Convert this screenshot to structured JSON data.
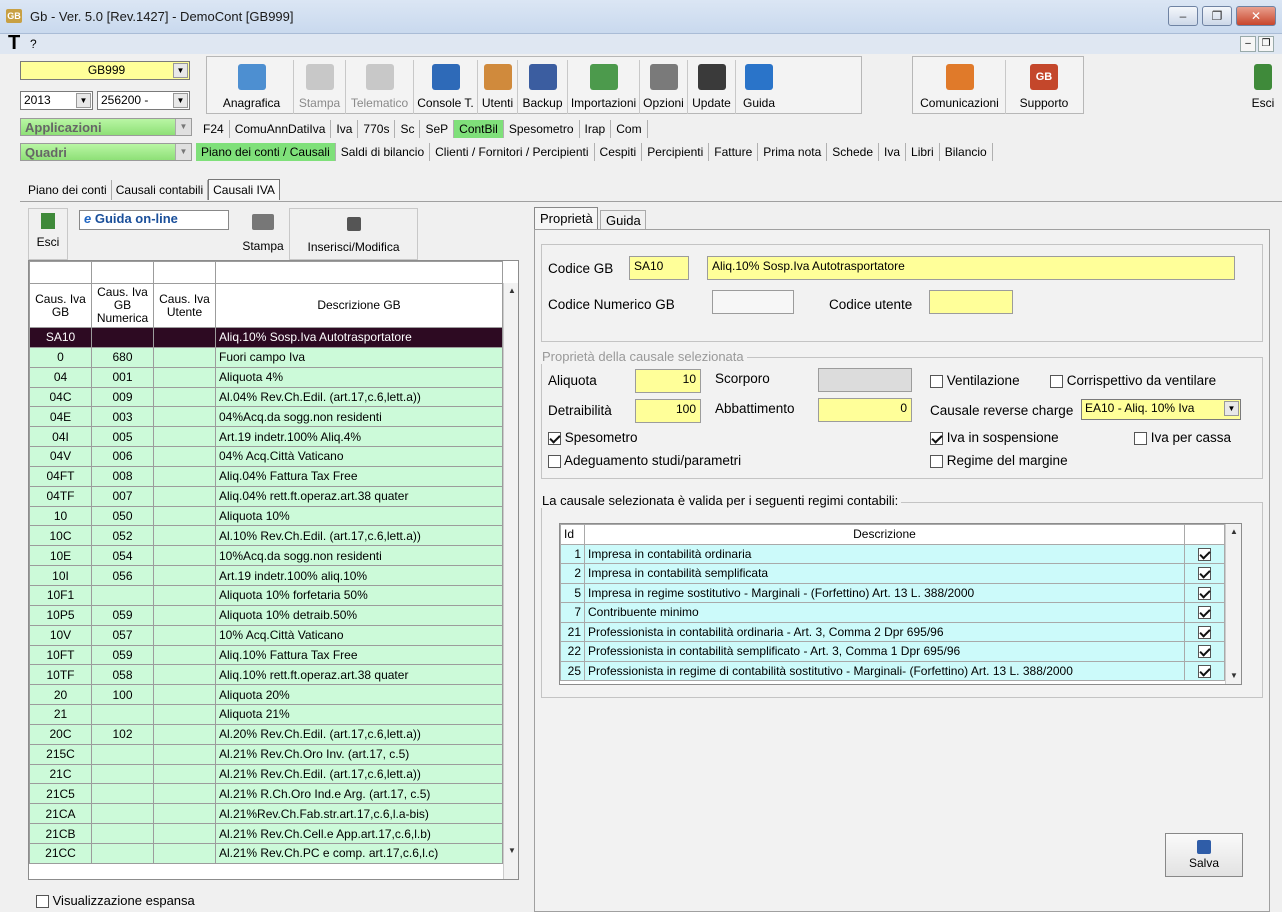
{
  "window": {
    "title": "Gb - Ver. 5.0 [Rev.1427] - DemoCont [GB999]",
    "icon_text": "GB",
    "minimize": "–",
    "restore": "❐",
    "close": "✕"
  },
  "menu": {
    "t": "T",
    "q": "?"
  },
  "company": {
    "code": "GB999",
    "year": "2013",
    "account": "256200 -"
  },
  "toolbar": {
    "buttons": [
      {
        "label": "Anagrafica",
        "icon": "address-card-icon",
        "enabled": true
      },
      {
        "label": "Stampa",
        "icon": "printer-icon",
        "enabled": false
      },
      {
        "label": "Telematico",
        "icon": "telematic-icon",
        "enabled": false
      },
      {
        "label": "Console T.",
        "icon": "console-icon",
        "enabled": true
      },
      {
        "label": "Utenti",
        "icon": "users-icon",
        "enabled": true
      },
      {
        "label": "Backup",
        "icon": "backup-icon",
        "enabled": true
      },
      {
        "label": "Importazioni",
        "icon": "import-icon",
        "enabled": true
      },
      {
        "label": "Opzioni",
        "icon": "wrench-icon",
        "enabled": true
      },
      {
        "label": "Update",
        "icon": "update-icon",
        "enabled": true
      },
      {
        "label": "Guida",
        "icon": "help-icon",
        "enabled": true
      }
    ],
    "comunicazioni": "Comunicazioni",
    "supporto": "Supporto",
    "esci": "Esci"
  },
  "nav": {
    "applicazioni": "Applicazioni",
    "quadri": "Quadri",
    "apps": [
      "F24",
      "ComuAnnDatiIva",
      "Iva",
      "770s",
      "Sc",
      "SeP",
      "ContBil",
      "Spesometro",
      "Irap",
      "Com"
    ],
    "active_app": "ContBil",
    "quadri_items": [
      "Piano dei conti / Causali",
      "Saldi di bilancio",
      "Clienti / Fornitori / Percipienti",
      "Cespiti",
      "Percipienti",
      "Fatture",
      "Prima nota",
      "Schede",
      "Iva",
      "Libri",
      "Bilancio"
    ],
    "active_quadro": "Piano dei conti / Causali"
  },
  "subtabs": {
    "items": [
      "Piano dei conti",
      "Causali contabili",
      "Causali IVA"
    ],
    "active": "Causali IVA"
  },
  "left": {
    "esci": "Esci",
    "guida": "Guida on-line",
    "stampa": "Stampa",
    "inserisci": "Inserisci/Modifica",
    "headers": [
      "Caus. Iva GB",
      "Caus. Iva GB Numerica",
      "Caus. Iva Utente",
      "Descrizione GB"
    ],
    "rows": [
      [
        "SA10",
        "",
        "",
        "Aliq.10% Sosp.Iva Autotrasportatore"
      ],
      [
        "0",
        "680",
        "",
        "Fuori campo Iva"
      ],
      [
        "04",
        "001",
        "",
        "Aliquota 4%"
      ],
      [
        "04C",
        "009",
        "",
        "Al.04% Rev.Ch.Edil. (art.17,c.6,lett.a))"
      ],
      [
        "04E",
        "003",
        "",
        "04%Acq.da sogg.non residenti"
      ],
      [
        "04I",
        "005",
        "",
        "Art.19 indetr.100% Aliq.4%"
      ],
      [
        "04V",
        "006",
        "",
        "04% Acq.Città Vaticano"
      ],
      [
        "04FT",
        "008",
        "",
        "Aliq.04% Fattura Tax Free"
      ],
      [
        "04TF",
        "007",
        "",
        "Aliq.04% rett.ft.operaz.art.38 quater"
      ],
      [
        "10",
        "050",
        "",
        "Aliquota 10%"
      ],
      [
        "10C",
        "052",
        "",
        "Al.10% Rev.Ch.Edil. (art.17,c.6,lett.a))"
      ],
      [
        "10E",
        "054",
        "",
        "10%Acq.da sogg.non residenti"
      ],
      [
        "10I",
        "056",
        "",
        "Art.19 indetr.100% aliq.10%"
      ],
      [
        "10F1",
        "",
        "",
        "Aliquota 10% forfetaria 50%"
      ],
      [
        "10P5",
        "059",
        "",
        "Aliquota 10% detraib.50%"
      ],
      [
        "10V",
        "057",
        "",
        "10% Acq.Città Vaticano"
      ],
      [
        "10FT",
        "059",
        "",
        "Aliq.10% Fattura Tax Free"
      ],
      [
        "10TF",
        "058",
        "",
        "Aliq.10% rett.ft.operaz.art.38 quater"
      ],
      [
        "20",
        "100",
        "",
        "Aliquota 20%"
      ],
      [
        "21",
        "",
        "",
        "Aliquota 21%"
      ],
      [
        "20C",
        "102",
        "",
        "Al.20% Rev.Ch.Edil. (art.17,c.6,lett.a))"
      ],
      [
        "215C",
        "",
        "",
        "Al.21% Rev.Ch.Oro Inv. (art.17, c.5)"
      ],
      [
        "21C",
        "",
        "",
        "Al.21% Rev.Ch.Edil. (art.17,c.6,lett.a))"
      ],
      [
        "21C5",
        "",
        "",
        "Al.21% R.Ch.Oro Ind.e Arg. (art.17, c.5)"
      ],
      [
        "21CA",
        "",
        "",
        "Al.21%Rev.Ch.Fab.str.art.17,c.6,l.a-bis)"
      ],
      [
        "21CB",
        "",
        "",
        "Al.21% Rev.Ch.Cell.e App.art.17,c.6,l.b)"
      ],
      [
        "21CC",
        "",
        "",
        "Al.21% Rev.Ch.PC e comp. art.17,c.6,l.c)"
      ]
    ],
    "expanded_label": "Visualizzazione espansa"
  },
  "right": {
    "tabs": [
      "Proprietà",
      "Guida"
    ],
    "codice_gb_label": "Codice GB",
    "codice_gb": "SA10",
    "descrizione": "Aliq.10% Sosp.Iva Autotrasportatore",
    "codice_num_label": "Codice Numerico GB",
    "codice_num": "",
    "codice_utente_label": "Codice utente",
    "codice_utente": "",
    "props_legend": "Proprietà della causale selezionata",
    "aliquota_label": "Aliquota",
    "aliquota": "10",
    "scorporo_label": "Scorporo",
    "scorporo": "",
    "detraibilita_label": "Detraibilità",
    "detraibilita": "100",
    "abbattimento_label": "Abbattimento",
    "abbattimento": "0",
    "ventilazione": "Ventilazione",
    "corrispettivo": "Corrispettivo da ventilare",
    "reverse_label": "Causale reverse charge",
    "reverse_value": "EA10 - Aliq. 10% Iva",
    "spesometro": "Spesometro",
    "iva_sospensione": "Iva in sospensione",
    "iva_cassa": "Iva per cassa",
    "adeguamento": "Adeguamento studi/parametri",
    "regime_margine": "Regime del margine",
    "regimi_legend": "La causale selezionata è valida per i seguenti regimi contabili:",
    "regimi_headers": [
      "Id",
      "Descrizione"
    ],
    "regimi": [
      {
        "id": "1",
        "desc": "Impresa  in contabilità ordinaria",
        "checked": true
      },
      {
        "id": "2",
        "desc": "Impresa  in contabilità semplificata",
        "checked": true
      },
      {
        "id": "5",
        "desc": "Impresa in regime sostitutivo - Marginali - (Forfettino) Art. 13 L. 388/2000",
        "checked": true
      },
      {
        "id": "7",
        "desc": "Contribuente minimo",
        "checked": true
      },
      {
        "id": "21",
        "desc": "Professionista in contabilità ordinaria - Art. 3, Comma 2 Dpr 695/96",
        "checked": true
      },
      {
        "id": "22",
        "desc": "Professionista in contabilità semplificato - Art. 3, Comma 1 Dpr 695/96",
        "checked": true
      },
      {
        "id": "25",
        "desc": "Professionista in regime di contabilità sostitutivo - Marginali- (Forfettino) Art. 13 L. 388/2000",
        "checked": true
      }
    ],
    "salva": "Salva"
  },
  "checks": {
    "ventilazione": false,
    "corrispettivo": false,
    "spesometro": true,
    "iva_sospensione": true,
    "iva_cassa": false,
    "adeguamento": false,
    "regime_margine": false,
    "visualizzazione": false
  }
}
